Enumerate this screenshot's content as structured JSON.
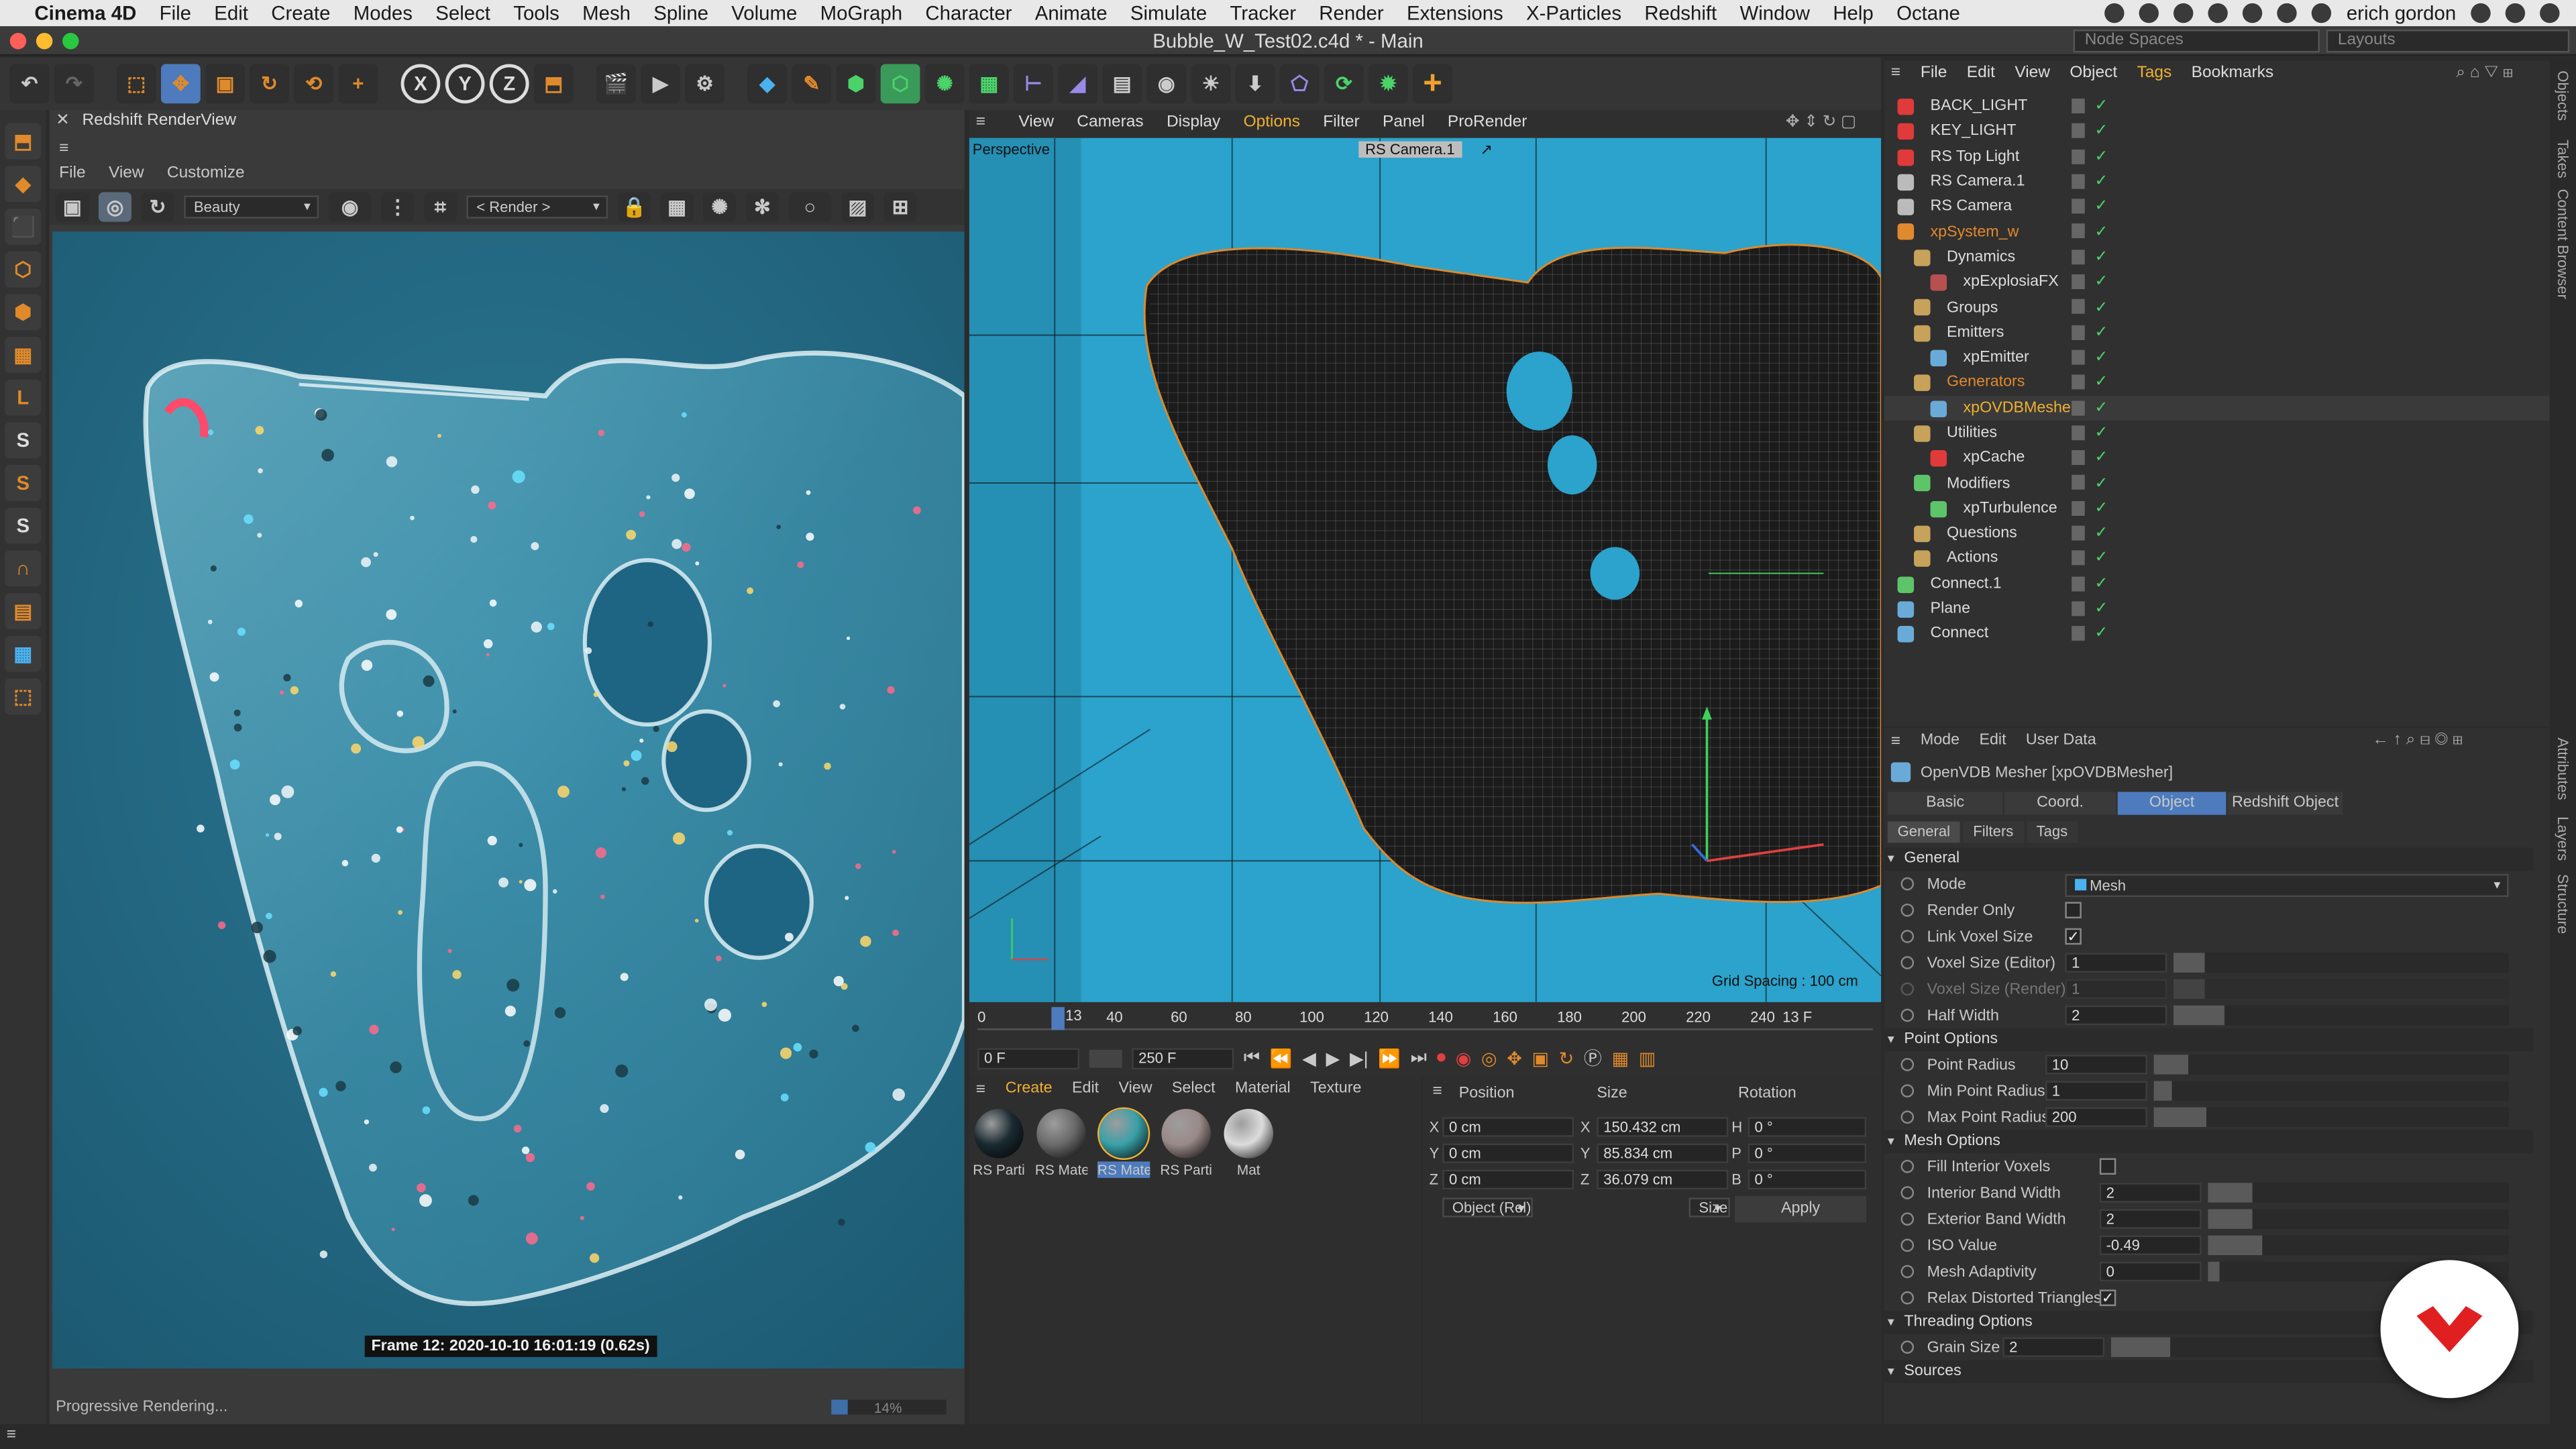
{
  "mac_menu": {
    "app": "Cinema 4D",
    "items": [
      "File",
      "Edit",
      "Create",
      "Modes",
      "Select",
      "Tools",
      "Mesh",
      "Spline",
      "Volume",
      "MoGraph",
      "Character",
      "Animate",
      "Simulate",
      "Tracker",
      "Render",
      "Extensions",
      "X-Particles",
      "Redshift",
      "Window",
      "Help",
      "Octane"
    ],
    "user": "erich gordon"
  },
  "window": {
    "title": "Bubble_W_Test02.c4d * - Main",
    "node_spaces": "Node Spaces",
    "layouts": "Layouts"
  },
  "renderview": {
    "title": "Redshift RenderView",
    "menu": [
      "File",
      "View",
      "Customize"
    ],
    "aov": "Beauty",
    "render_target": "< Render >",
    "frame_info": "Frame  12:  2020-10-10  16:01:19  (0.62s)",
    "status": "Progressive Rendering...",
    "progress": "14%",
    "progress_value": 0.14
  },
  "viewport": {
    "menu": [
      "View",
      "Cameras",
      "Display",
      "Options",
      "Filter",
      "Panel",
      "ProRender"
    ],
    "active_menu": "Options",
    "label": "Perspective",
    "camera": "RS Camera.1",
    "grid": "Grid Spacing : 100 cm"
  },
  "timeline": {
    "ticks": [
      "0",
      "40",
      "60",
      "80",
      "100",
      "120",
      "140",
      "160",
      "180",
      "200",
      "220",
      "240"
    ],
    "marker": "13",
    "end_label": "13 F",
    "current": "0 F",
    "end": "250 F",
    "playhead": 13,
    "max": 250
  },
  "materials": {
    "menu": [
      "Create",
      "Edit",
      "View",
      "Select",
      "Material",
      "Texture"
    ],
    "items": [
      {
        "label": "RS Parti",
        "color": "#1a2a30"
      },
      {
        "label": "RS Mate",
        "color": "#6a6a6a"
      },
      {
        "label": "RS Mate",
        "color": "#3aa0a8",
        "selected": true
      },
      {
        "label": "RS Parti",
        "color": "#9a8a88"
      },
      {
        "label": "Mat",
        "color": "#dcdcdc"
      }
    ]
  },
  "coords": {
    "headers": [
      "Position",
      "Size",
      "Rotation"
    ],
    "rows": [
      {
        "a": "X",
        "pos": "0 cm",
        "b": "X",
        "size": "150.432 cm",
        "c": "H",
        "rot": "0 °"
      },
      {
        "a": "Y",
        "pos": "0 cm",
        "b": "Y",
        "size": "85.834 cm",
        "c": "P",
        "rot": "0 °"
      },
      {
        "a": "Z",
        "pos": "0 cm",
        "b": "Z",
        "size": "36.079 cm",
        "c": "B",
        "rot": "0 °"
      }
    ],
    "mode": "Object (Rel)",
    "size_mode": "Size",
    "apply": "Apply"
  },
  "objects": {
    "menu": [
      "File",
      "Edit",
      "View",
      "Object",
      "Tags",
      "Bookmarks"
    ],
    "items": [
      {
        "name": "BACK_LIGHT",
        "indent": 0,
        "color": "#ddd",
        "icon": "#e03a3a"
      },
      {
        "name": "KEY_LIGHT",
        "indent": 0,
        "color": "#ddd",
        "icon": "#e03a3a"
      },
      {
        "name": "RS Top Light",
        "indent": 0,
        "color": "#ddd",
        "icon": "#e03a3a"
      },
      {
        "name": "RS Camera.1",
        "indent": 0,
        "color": "#ddd",
        "icon": "#bbbbbb"
      },
      {
        "name": "RS Camera",
        "indent": 0,
        "color": "#ddd",
        "icon": "#bbbbbb"
      },
      {
        "name": "xpSystem_w",
        "indent": 0,
        "color": "#e0892e",
        "icon": "#e0892e"
      },
      {
        "name": "Dynamics",
        "indent": 1,
        "color": "#ddd",
        "icon": "#c7a25a"
      },
      {
        "name": "xpExplosiaFX",
        "indent": 2,
        "color": "#ddd",
        "icon": "#b85050"
      },
      {
        "name": "Groups",
        "indent": 1,
        "color": "#ddd",
        "icon": "#c7a25a"
      },
      {
        "name": "Emitters",
        "indent": 1,
        "color": "#ddd",
        "icon": "#c7a25a"
      },
      {
        "name": "xpEmitter",
        "indent": 2,
        "color": "#ddd",
        "icon": "#6aaad8"
      },
      {
        "name": "Generators",
        "indent": 1,
        "color": "#e0892e",
        "icon": "#c7a25a"
      },
      {
        "name": "xpOVDBMesher",
        "indent": 2,
        "color": "#f0b030",
        "icon": "#6aaad8",
        "selected": true
      },
      {
        "name": "Utilities",
        "indent": 1,
        "color": "#ddd",
        "icon": "#c7a25a"
      },
      {
        "name": "xpCache",
        "indent": 2,
        "color": "#ddd",
        "icon": "#e03a3a"
      },
      {
        "name": "Modifiers",
        "indent": 1,
        "color": "#ddd",
        "icon": "#5ec46a"
      },
      {
        "name": "xpTurbulence",
        "indent": 2,
        "color": "#ddd",
        "icon": "#5ec46a"
      },
      {
        "name": "Questions",
        "indent": 1,
        "color": "#ddd",
        "icon": "#c7a25a"
      },
      {
        "name": "Actions",
        "indent": 1,
        "color": "#ddd",
        "icon": "#c7a25a"
      },
      {
        "name": "Connect.1",
        "indent": 0,
        "color": "#ddd",
        "icon": "#5ec46a"
      },
      {
        "name": "Plane",
        "indent": 0,
        "color": "#ddd",
        "icon": "#6aaad8"
      },
      {
        "name": "Connect",
        "indent": 0,
        "color": "#ddd",
        "icon": "#6aaad8"
      }
    ]
  },
  "attributes": {
    "menu": [
      "Mode",
      "Edit",
      "User Data"
    ],
    "object_title": "OpenVDB Mesher [xpOVDBMesher]",
    "tabs": [
      "Basic",
      "Coord.",
      "Object",
      "Redshift Object"
    ],
    "active_tab": "Object",
    "subtabs": [
      "General",
      "Filters",
      "Tags"
    ],
    "sections": {
      "general": "General",
      "point": "Point Options",
      "mesh": "Mesh Options",
      "threading": "Threading Options",
      "sources": "Sources"
    },
    "general": [
      {
        "label": "Mode",
        "value": "Mesh",
        "type": "dropdown"
      },
      {
        "label": "Render Only",
        "value": "",
        "type": "check",
        "checked": false
      },
      {
        "label": "Link Voxel Size",
        "value": "✓",
        "type": "check",
        "checked": true
      },
      {
        "label": "Voxel Size (Editor)",
        "value": "1",
        "type": "num",
        "fill": 0.1
      },
      {
        "label": "Voxel Size (Render)",
        "value": "1",
        "type": "num",
        "fill": 0.1,
        "disabled": true
      },
      {
        "label": "Half Width",
        "value": "2",
        "type": "num",
        "fill": 0.2
      }
    ],
    "point": [
      {
        "label": "Point Radius",
        "value": "10",
        "fill": 0.1
      },
      {
        "label": "Min Point Radius",
        "value": "1",
        "fill": 0.02
      },
      {
        "label": "Max Point Radius",
        "value": "200",
        "fill": 0.2
      }
    ],
    "mesh": [
      {
        "label": "Fill Interior Voxels",
        "value": "",
        "type": "check",
        "checked": false
      },
      {
        "label": "Interior Band Width",
        "value": "2",
        "type": "num",
        "fill": 0.2
      },
      {
        "label": "Exterior Band Width",
        "value": "2",
        "type": "num",
        "fill": 0.2
      },
      {
        "label": "ISO Value",
        "value": "-0.49",
        "type": "num",
        "fill": 0.26
      },
      {
        "label": "Mesh Adaptivity",
        "value": "0",
        "type": "num",
        "fill": 0.0
      },
      {
        "label": "Relax Distorted Triangles",
        "value": "✓",
        "type": "check",
        "checked": true
      }
    ],
    "threading": [
      {
        "label": "Grain Size",
        "value": "2",
        "fill": 0.2
      }
    ]
  },
  "right_tabs": [
    "Objects",
    "Takes",
    "Content Browser",
    "Attributes",
    "Layers",
    "Structure"
  ]
}
